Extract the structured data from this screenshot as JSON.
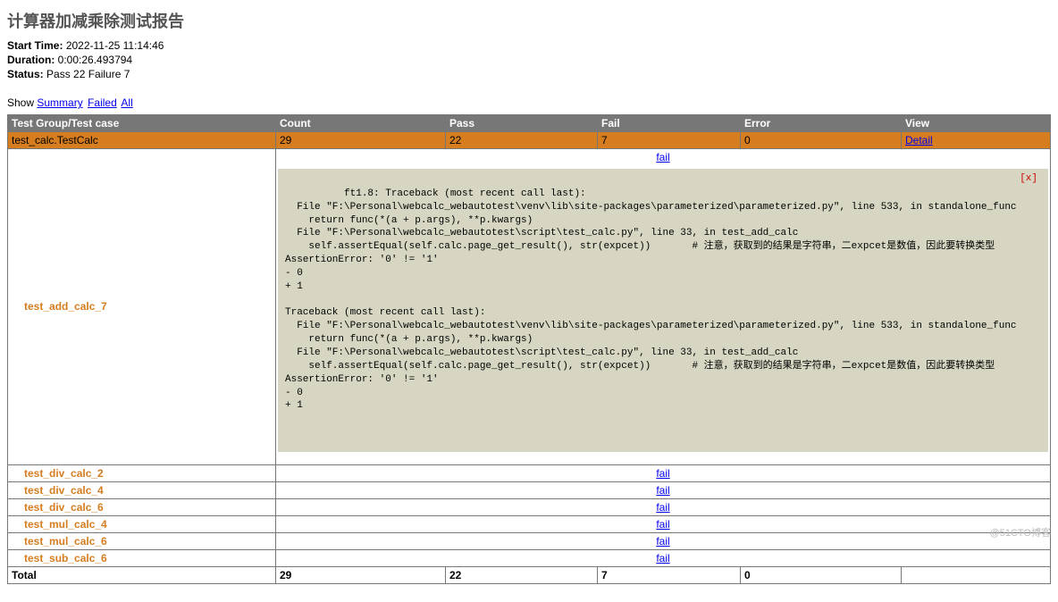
{
  "title": "计算器加减乘除测试报告",
  "meta": {
    "start_label": "Start Time:",
    "start_value": "2022-11-25 11:14:46",
    "duration_label": "Duration:",
    "duration_value": "0:00:26.493794",
    "status_label": "Status:",
    "status_value": "Pass 22 Failure 7"
  },
  "filters": {
    "show_label": "Show",
    "summary": "Summary",
    "failed": "Failed",
    "all": "All"
  },
  "columns": {
    "c0": "Test Group/Test case",
    "c1": "Count",
    "c2": "Pass",
    "c3": "Fail",
    "c4": "Error",
    "c5": "View"
  },
  "suite": {
    "name": "test_calc.TestCalc",
    "count": "29",
    "pass": "22",
    "fail": "7",
    "error": "0",
    "view": "Detail"
  },
  "expanded": {
    "name": "test_add_calc_7",
    "fail_link": "fail",
    "close": "[x]",
    "trace": "ft1.8: Traceback (most recent call last):\n  File \"F:\\Personal\\webcalc_webautotest\\venv\\lib\\site-packages\\parameterized\\parameterized.py\", line 533, in standalone_func\n    return func(*(a + p.args), **p.kwargs)\n  File \"F:\\Personal\\webcalc_webautotest\\script\\test_calc.py\", line 33, in test_add_calc\n    self.assertEqual(self.calc.page_get_result(), str(expcet))       # 注意，获取到的结果是字符串，二expcet是数值，因此要转换类型\nAssertionError: '0' != '1'\n- 0\n+ 1\n\nTraceback (most recent call last):\n  File \"F:\\Personal\\webcalc_webautotest\\venv\\lib\\site-packages\\parameterized\\parameterized.py\", line 533, in standalone_func\n    return func(*(a + p.args), **p.kwargs)\n  File \"F:\\Personal\\webcalc_webautotest\\script\\test_calc.py\", line 33, in test_add_calc\n    self.assertEqual(self.calc.page_get_result(), str(expcet))       # 注意，获取到的结果是字符串，二expcet是数值，因此要转换类型\nAssertionError: '0' != '1'\n- 0\n+ 1\n"
  },
  "cases": [
    {
      "name": "test_div_calc_2",
      "result": "fail"
    },
    {
      "name": "test_div_calc_4",
      "result": "fail"
    },
    {
      "name": "test_div_calc_6",
      "result": "fail"
    },
    {
      "name": "test_mul_calc_4",
      "result": "fail"
    },
    {
      "name": "test_mul_calc_6",
      "result": "fail"
    },
    {
      "name": "test_sub_calc_6",
      "result": "fail"
    }
  ],
  "total": {
    "label": "Total",
    "count": "29",
    "pass": "22",
    "fail": "7",
    "error": "0"
  },
  "watermark": "@51CTO博客"
}
